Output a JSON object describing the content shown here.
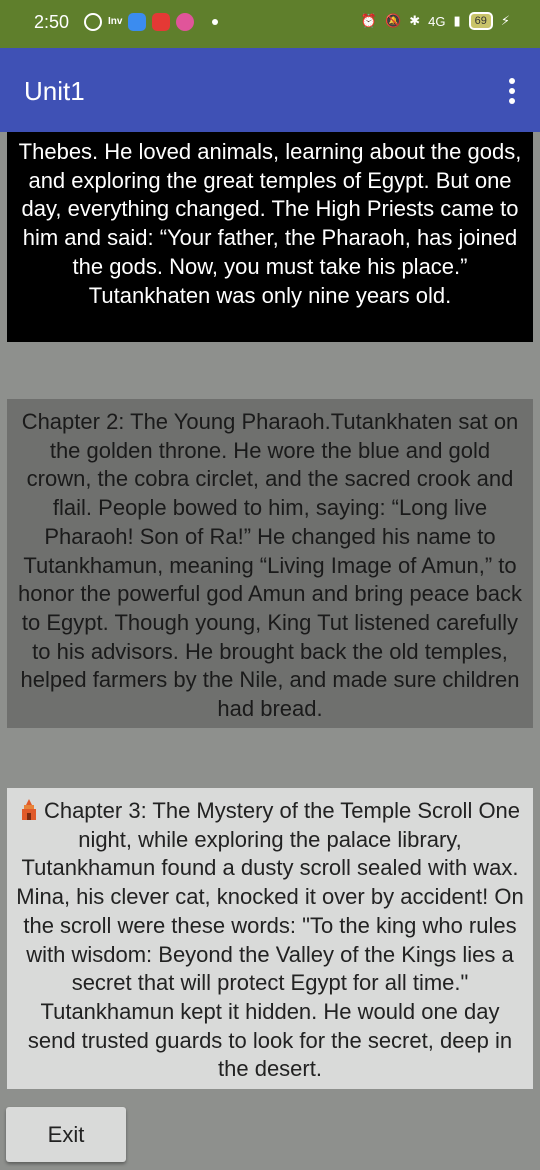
{
  "status_bar": {
    "time": "2:50",
    "inv_label": "Inv",
    "network": "4G",
    "battery": "69"
  },
  "app_bar": {
    "title": "Unit1",
    "menu_icon": "overflow-menu-icon"
  },
  "cards": [
    {
      "text": "Thebes. He loved animals, learning about the gods, and exploring the great temples of Egypt. But one day, everything changed. The High Priests came to him and said: “Your father, the Pharaoh, has joined the gods. Now, you must take his place.” Tutankhaten was only nine years old."
    },
    {
      "text": "Chapter 2: The Young Pharaoh.Tutankhaten sat on the golden throne. He wore the blue and gold crown, the cobra circlet, and the sacred crook and flail. People bowed to him, saying: “Long live Pharaoh! Son of Ra!” He changed his name to Tutankhamun, meaning “Living Image of Amun,” to honor the powerful god Amun and bring peace back to Egypt. Though young, King Tut listened carefully to his advisors. He brought back the old temples, helped farmers by the Nile, and made sure children had bread."
    },
    {
      "icon": "temple-icon",
      "text": "Chapter 3: The Mystery of the Temple Scroll One night, while exploring the palace library, Tutankhamun found a dusty scroll sealed with wax. Mina, his clever cat, knocked it over by accident! On the scroll were these words: \"To the king who rules with wisdom: Beyond the Valley of the Kings lies a secret that will protect Egypt for all time.\" Tutankhamun kept it hidden. He would one day send trusted guards to look for the secret, deep in the desert."
    }
  ],
  "exit_button": {
    "label": "Exit"
  },
  "colors": {
    "status_bar": "#5f7f2c",
    "app_bar": "#3f51b5",
    "background": "#8e908d"
  }
}
